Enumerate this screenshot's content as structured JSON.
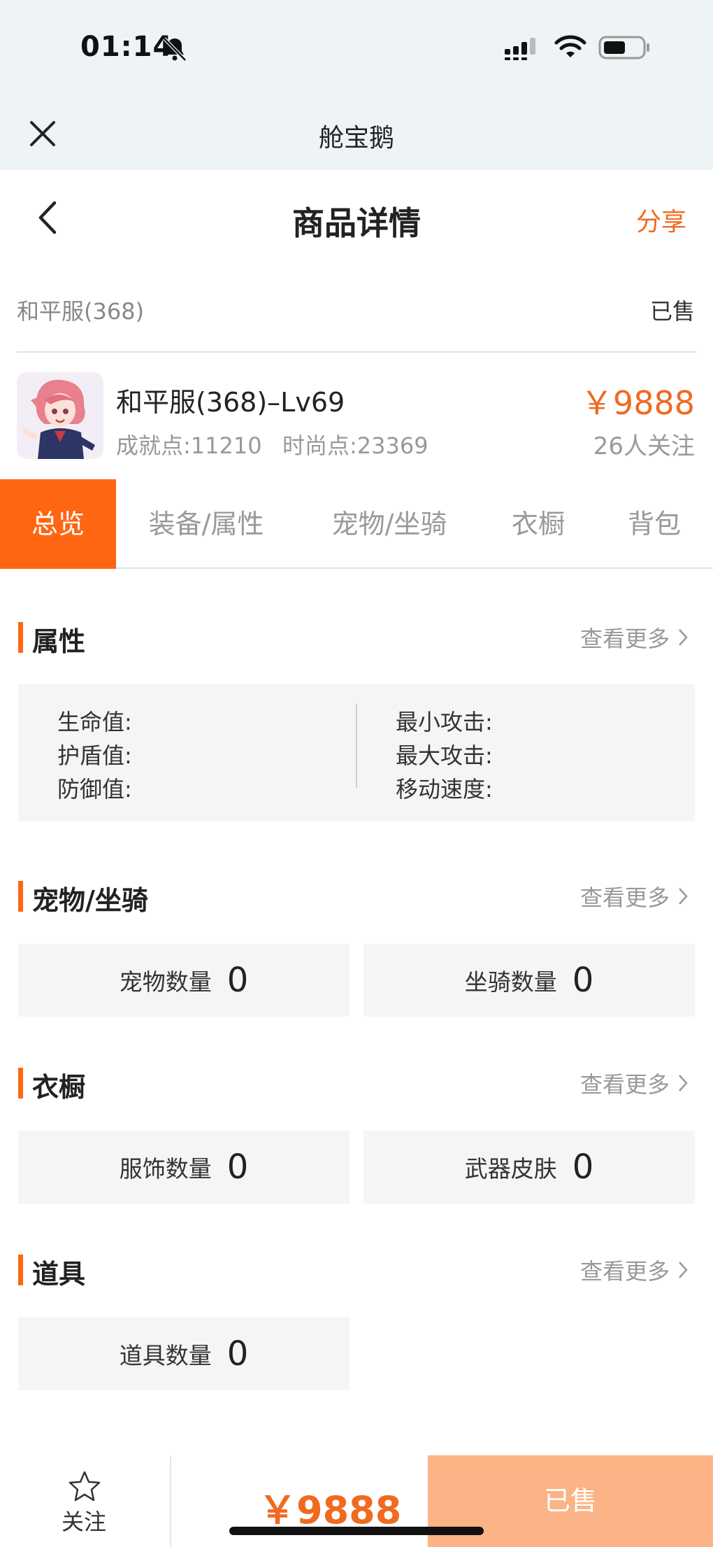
{
  "status_bar": {
    "time": "01:14"
  },
  "mini_program": {
    "title": "舱宝鹅"
  },
  "header": {
    "title": "商品详情",
    "share_label": "分享"
  },
  "listing": {
    "server": "和平服(368)",
    "status": "已售",
    "name": "和平服(368)–Lv69",
    "achievement_points": "成就点:11210",
    "fashion_points": "时尚点:23369",
    "price": "￥9888",
    "followers": "26人关注"
  },
  "tabs": [
    {
      "label": "总览",
      "active": true
    },
    {
      "label": "装备/属性",
      "active": false
    },
    {
      "label": "宠物/坐骑",
      "active": false
    },
    {
      "label": "衣橱",
      "active": false
    },
    {
      "label": "背包",
      "active": false
    }
  ],
  "sections": {
    "attributes": {
      "title": "属性",
      "more": "查看更多",
      "left": [
        "生命值:",
        "护盾值:",
        "防御值:"
      ],
      "right": [
        "最小攻击:",
        "最大攻击:",
        "移动速度:"
      ]
    },
    "pets": {
      "title": "宠物/坐骑",
      "more": "查看更多",
      "cards": [
        {
          "label": "宠物数量",
          "value": "0"
        },
        {
          "label": "坐骑数量",
          "value": "0"
        }
      ]
    },
    "wardrobe": {
      "title": "衣橱",
      "more": "查看更多",
      "cards": [
        {
          "label": "服饰数量",
          "value": "0"
        },
        {
          "label": "武器皮肤",
          "value": "0"
        }
      ]
    },
    "items": {
      "title": "道具",
      "more": "查看更多",
      "cards": [
        {
          "label": "道具数量",
          "value": "0"
        }
      ]
    }
  },
  "bottom_bar": {
    "follow_label": "关注",
    "price": "￥9888",
    "sold_label": "已售"
  },
  "colors": {
    "accent": "#ff6612",
    "price": "#f06a1f",
    "sold_button": "#fcb385"
  }
}
